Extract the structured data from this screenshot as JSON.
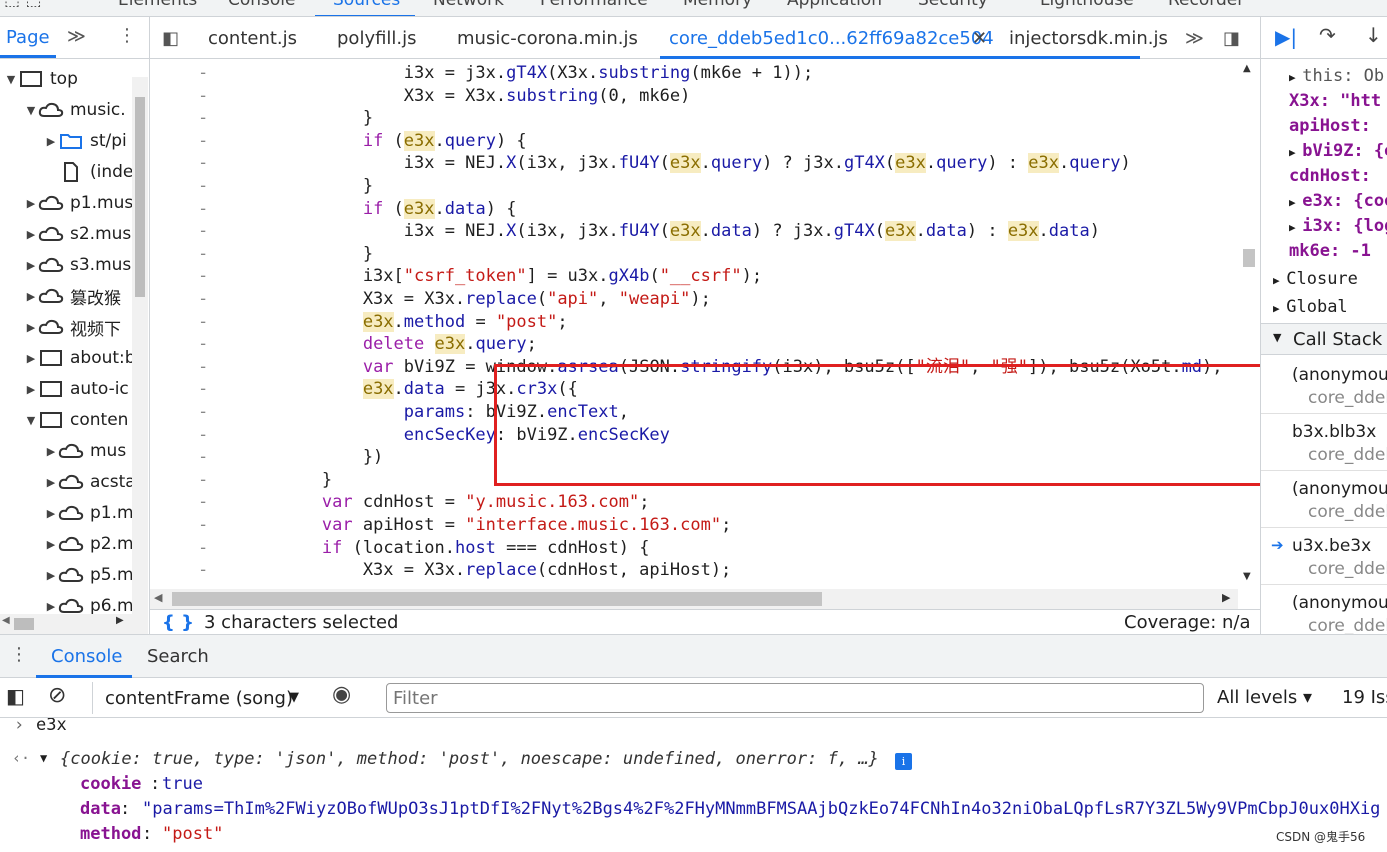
{
  "devtools_tabs": [
    "Elements",
    "Console",
    "Sources",
    "Network",
    "Performance",
    "Memory",
    "Application",
    "Security",
    "Lighthouse",
    "Recorder"
  ],
  "navigator": {
    "tab_label": "Page",
    "items": [
      {
        "label": "top",
        "icon": "frame-icon",
        "depth": 0,
        "open": true
      },
      {
        "label": "music.",
        "icon": "cloud-icon",
        "depth": 1,
        "open": true
      },
      {
        "label": "st/pi",
        "icon": "folder-icon",
        "depth": 2,
        "open": false
      },
      {
        "label": "(inde",
        "icon": "file-icon",
        "depth": 2,
        "open": null
      },
      {
        "label": "p1.mus",
        "icon": "cloud-icon",
        "depth": 1,
        "open": false
      },
      {
        "label": "s2.mus",
        "icon": "cloud-icon",
        "depth": 1,
        "open": false
      },
      {
        "label": "s3.mus",
        "icon": "cloud-icon",
        "depth": 1,
        "open": false
      },
      {
        "label": "篡改猴",
        "icon": "cloud-icon",
        "depth": 1,
        "open": false
      },
      {
        "label": "视频下",
        "icon": "cloud-icon",
        "depth": 1,
        "open": false
      },
      {
        "label": "about:b",
        "icon": "frame-icon",
        "depth": 1,
        "open": false
      },
      {
        "label": "auto-ic",
        "icon": "frame-icon",
        "depth": 1,
        "open": false
      },
      {
        "label": "conten",
        "icon": "frame-icon",
        "depth": 1,
        "open": true
      },
      {
        "label": "mus",
        "icon": "cloud-icon",
        "depth": 2,
        "open": false
      },
      {
        "label": "acsta",
        "icon": "cloud-icon",
        "depth": 2,
        "open": false
      },
      {
        "label": "p1.m",
        "icon": "cloud-icon",
        "depth": 2,
        "open": false
      },
      {
        "label": "p2.m",
        "icon": "cloud-icon",
        "depth": 2,
        "open": false
      },
      {
        "label": "p5.m",
        "icon": "cloud-icon",
        "depth": 2,
        "open": false
      },
      {
        "label": "p6.m",
        "icon": "cloud-icon",
        "depth": 2,
        "open": false
      }
    ]
  },
  "file_tabs": [
    "content.js",
    "polyfill.js",
    "music-corona.min.js",
    "core_ddeb5ed1c0...62ff69a82ce504",
    "injectorsdk.min.js"
  ],
  "active_file_tab": "core_ddeb5ed1c0...62ff69a82ce504",
  "code_lines": [
    "                i3x = j3x.gT4X(X3x.substring(mk6e + 1));",
    "                X3x = X3x.substring(0, mk6e)",
    "            }",
    "            if (e3x.query) {",
    "                i3x = NEJ.X(i3x, j3x.fU4Y(e3x.query) ? j3x.gT4X(e3x.query) : e3x.query)",
    "            }",
    "            if (e3x.data) {",
    "                i3x = NEJ.X(i3x, j3x.fU4Y(e3x.data) ? j3x.gT4X(e3x.data) : e3x.data)",
    "            }",
    "            i3x[\"csrf_token\"] = u3x.gX4b(\"__csrf\");",
    "            X3x = X3x.replace(\"api\", \"weapi\");",
    "            e3x.method = \"post\";",
    "            delete e3x.query;",
    "            var bVi9Z = window.asrsea(JSON.stringify(i3x), bsu5z([\"流泪\", \"强\"]), bsu5z(Xo5t.md),",
    "            e3x.data = j3x.cr3x({",
    "                params: bVi9Z.encText,",
    "                encSecKey: bVi9Z.encSecKey",
    "            })",
    "        }",
    "        var cdnHost = \"y.music.163.com\";",
    "        var apiHost = \"interface.music.163.com\";",
    "        if (location.host === cdnHost) {",
    "            X3x = X3x.replace(cdnHost, apiHost);"
  ],
  "line_marker": "-",
  "status": {
    "selection": "3 characters selected",
    "coverage": "Coverage: n/a",
    "format_icon": "{ }"
  },
  "scope": {
    "rows": [
      "this: Ob",
      "X3x: \"htt",
      "apiHost:",
      "bVi9Z: {e",
      "cdnHost:",
      "e3x: {coo",
      "i3x: {log",
      "mk6e: -1"
    ],
    "closure": "Closure",
    "global": "Global",
    "call_stack_title": "Call Stack",
    "frames": [
      {
        "fn": "(anonymous",
        "file": "core_ddeb"
      },
      {
        "fn": "b3x.blb3x",
        "file": "core_ddeb"
      },
      {
        "fn": "(anonymous",
        "file": "core_ddeb"
      },
      {
        "fn": "u3x.be3x",
        "file": "core_ddeb",
        "current": true
      },
      {
        "fn": "(anonymous",
        "file": "core_ddeb"
      }
    ]
  },
  "drawer": {
    "tabs": [
      "Console",
      "Search"
    ],
    "active": "Console"
  },
  "console_toolbar": {
    "context": "contentFrame (song)",
    "filter_placeholder": "Filter",
    "levels": "All levels",
    "issues": "19 Iss"
  },
  "console_output": {
    "input": "e3x",
    "summary": "{cookie: true, type: 'json', method: 'post', noescape: undefined, onerror: f, …}",
    "cookie_key": "cookie",
    "cookie_val": "true",
    "data_key": "data",
    "data_val": "\"params=ThIm%2FWiyzOBofWUpO3sJ1ptDfI%2FNyt%2Bgs4%2F%2FHyMNmmBFMSAAjbQzkEo74FCNhIn4o32niObaLQpfLsR7Y3ZL5Wy9VPmCbpJ0ux0HXig",
    "method_key": "method",
    "method_val": "\"post\""
  },
  "watermark": "CSDN @鬼手56",
  "colors": {
    "accent": "#1a73e8",
    "highlight_box": "#e02020"
  }
}
